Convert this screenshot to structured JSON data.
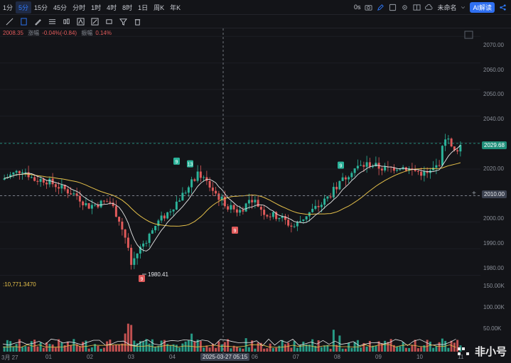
{
  "toolbar": {
    "timeframes": [
      "1分",
      "5分",
      "15分",
      "45分",
      "分时",
      "1时",
      "4时",
      "8时",
      "1日",
      "周K",
      "年K"
    ],
    "active_timeframe": "5分",
    "right_value": "0s",
    "layout_name": "未命名",
    "ai_button_label": "AI解读"
  },
  "info_bar": {
    "close": "2008.35",
    "change_label": "涨幅",
    "change_value": "-0.04%(-0.84)",
    "amplitude_label": "振幅",
    "amplitude_value": "0.14%"
  },
  "price_axis": {
    "ticks": [
      "2070.00",
      "2060.00",
      "2050.00",
      "2040.00",
      "2030.00",
      "2020.00",
      "2010.00",
      "2000.00",
      "1990.00",
      "1980.00"
    ],
    "current_price": "2029.68",
    "crosshair_price": "2010.00"
  },
  "volume_axis": {
    "ticks": [
      "150.00K",
      "100.00K",
      "50.00K"
    ],
    "label": ":10,771.3470"
  },
  "time_axis": {
    "ticks": [
      "3月 27",
      "01",
      "02",
      "03",
      "04",
      "06",
      "07",
      "08",
      "09",
      "10",
      "11"
    ],
    "crosshair_time": "2025-03-27 05:15"
  },
  "annotations": {
    "low_label": "1980.41",
    "markers": [
      "9",
      "9",
      "13",
      "9",
      "9"
    ]
  },
  "watermark": {
    "text": "非小号"
  },
  "colors": {
    "up": "#2bb39a",
    "down": "#e05a5a",
    "ma_fast": "#e6e6e6",
    "ma_slow": "#e5c04a",
    "accent": "#2f7bff"
  },
  "chart_data": {
    "type": "candlestick",
    "y_range": [
      1978,
      2073
    ],
    "ticks": [
      2070,
      2060,
      2050,
      2040,
      2030,
      2020,
      2010,
      2000,
      1990,
      1980
    ],
    "current_price": 2029.68,
    "low_annotation": 1980.41,
    "path_points": [
      [
        0,
        2016
      ],
      [
        10,
        2018
      ],
      [
        20,
        2020
      ],
      [
        30,
        2016
      ],
      [
        40,
        2016
      ],
      [
        50,
        2014
      ],
      [
        60,
        2012
      ],
      [
        70,
        2010
      ],
      [
        80,
        2006
      ],
      [
        90,
        2007
      ],
      [
        100,
        2008
      ],
      [
        108,
        2002
      ],
      [
        115,
        1994
      ],
      [
        120,
        1984
      ],
      [
        128,
        1990
      ],
      [
        135,
        1994
      ],
      [
        145,
        2000
      ],
      [
        155,
        2004
      ],
      [
        165,
        2009
      ],
      [
        175,
        2014
      ],
      [
        182,
        2019
      ],
      [
        192,
        2014
      ],
      [
        200,
        2010
      ],
      [
        210,
        2006
      ],
      [
        220,
        2004
      ],
      [
        232,
        2009
      ],
      [
        245,
        2003
      ],
      [
        258,
        2002
      ],
      [
        270,
        1998
      ],
      [
        283,
        2003
      ],
      [
        297,
        2007
      ],
      [
        310,
        2013
      ],
      [
        325,
        2020
      ],
      [
        340,
        2022
      ],
      [
        355,
        2020
      ],
      [
        370,
        2021
      ],
      [
        385,
        2019
      ],
      [
        395,
        2018
      ],
      [
        405,
        2022
      ],
      [
        412,
        2034
      ],
      [
        418,
        2026
      ],
      [
        425,
        2029
      ]
    ]
  }
}
